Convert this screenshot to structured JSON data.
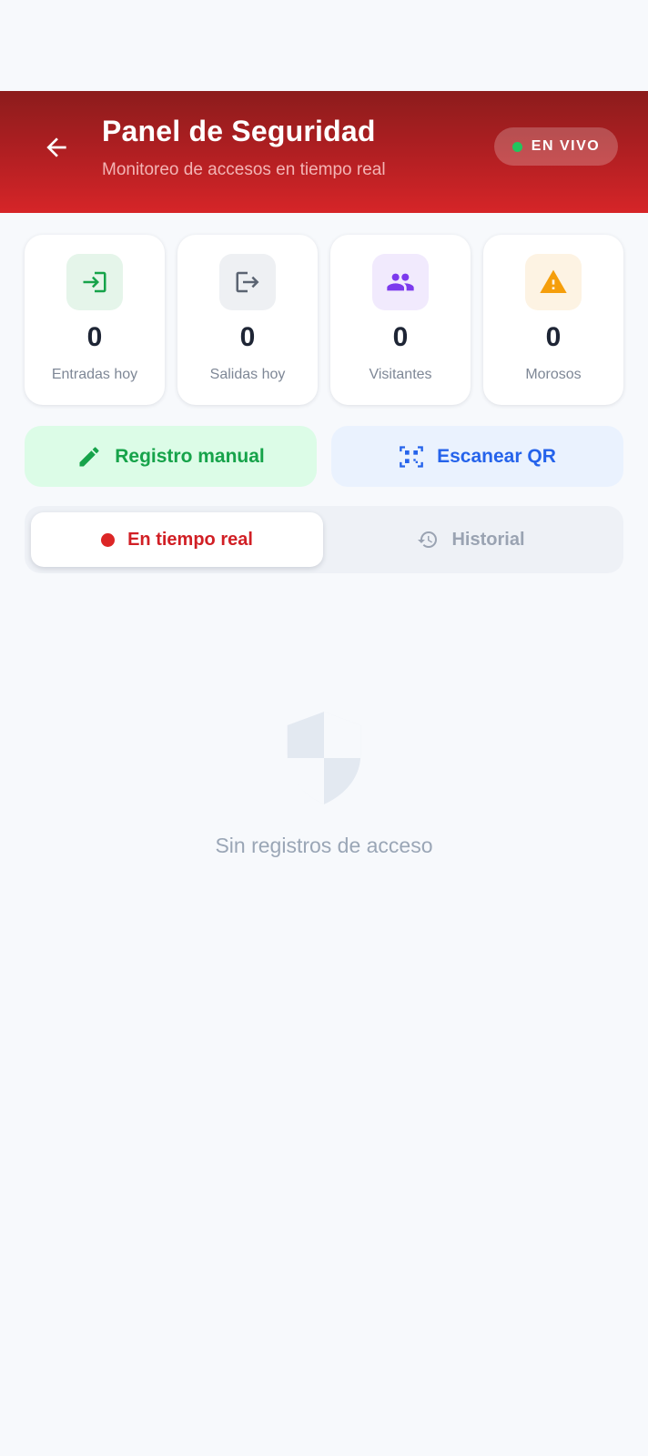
{
  "header": {
    "title": "Panel de Seguridad",
    "subtitle": "Monitoreo de accesos en tiempo real",
    "live_badge": "EN VIVO",
    "back_icon": "arrow-left-icon",
    "gradient": [
      "#8c1c1c",
      "#d62528"
    ]
  },
  "stats": [
    {
      "value": "0",
      "label": "Entradas hoy",
      "icon": "login-icon",
      "icon_color": "#16a34a",
      "bg": "#e5f5ea"
    },
    {
      "value": "0",
      "label": "Salidas hoy",
      "icon": "logout-icon",
      "icon_color": "#5b6472",
      "bg": "#eef0f3"
    },
    {
      "value": "0",
      "label": "Visitantes",
      "icon": "people-icon",
      "icon_color": "#7c3aed",
      "bg": "#f1eafd"
    },
    {
      "value": "0",
      "label": "Morosos",
      "icon": "warning-icon",
      "icon_color": "#f59e0b",
      "bg": "#fdf3e3"
    }
  ],
  "actions": {
    "manual_label": "Registro manual",
    "manual_icon": "pencil-icon",
    "qr_label": "Escanear QR",
    "qr_icon": "qr-scan-icon"
  },
  "tabs": {
    "live_label": "En tiempo real",
    "history_label": "Historial",
    "history_icon": "history-icon",
    "active": "En tiempo real"
  },
  "empty_state": {
    "icon": "shield-icon",
    "text": "Sin registros de acceso"
  },
  "colors": {
    "accent_red": "#d11f25",
    "live_green": "#22c55e",
    "background": "#f7f9fc"
  }
}
